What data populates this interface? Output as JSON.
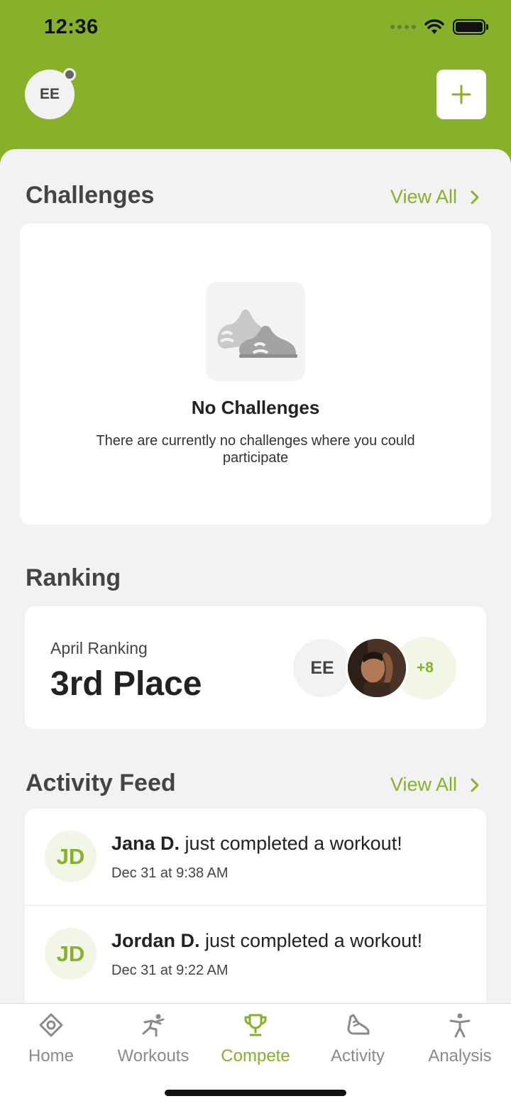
{
  "status_bar": {
    "time": "12:36"
  },
  "header": {
    "avatar_initials": "EE",
    "add_icon": "plus-icon"
  },
  "challenges": {
    "title": "Challenges",
    "view_all": "View All",
    "empty_title": "No Challenges",
    "empty_description": "There are currently no challenges where you could participate"
  },
  "ranking": {
    "title": "Ranking",
    "label": "April Ranking",
    "value": "3rd Place",
    "avatar_initials": "EE",
    "more_count": "+8"
  },
  "activity_feed": {
    "title": "Activity Feed",
    "view_all": "View All",
    "items": [
      {
        "initials": "JD",
        "name": "Jana D.",
        "message": " just completed a workout!",
        "time": "Dec 31 at 9:38 AM"
      },
      {
        "initials": "JD",
        "name": "Jordan D.",
        "message": " just completed a workout!",
        "time": "Dec 31 at 9:22 AM"
      }
    ]
  },
  "tabs": [
    {
      "label": "Home",
      "icon": "home-icon"
    },
    {
      "label": "Workouts",
      "icon": "workouts-icon"
    },
    {
      "label": "Compete",
      "icon": "trophy-icon",
      "active": true
    },
    {
      "label": "Activity",
      "icon": "shoe-icon"
    },
    {
      "label": "Analysis",
      "icon": "person-icon"
    }
  ],
  "colors": {
    "accent": "#87b12a",
    "background": "#f2f2f2",
    "card": "#ffffff"
  }
}
